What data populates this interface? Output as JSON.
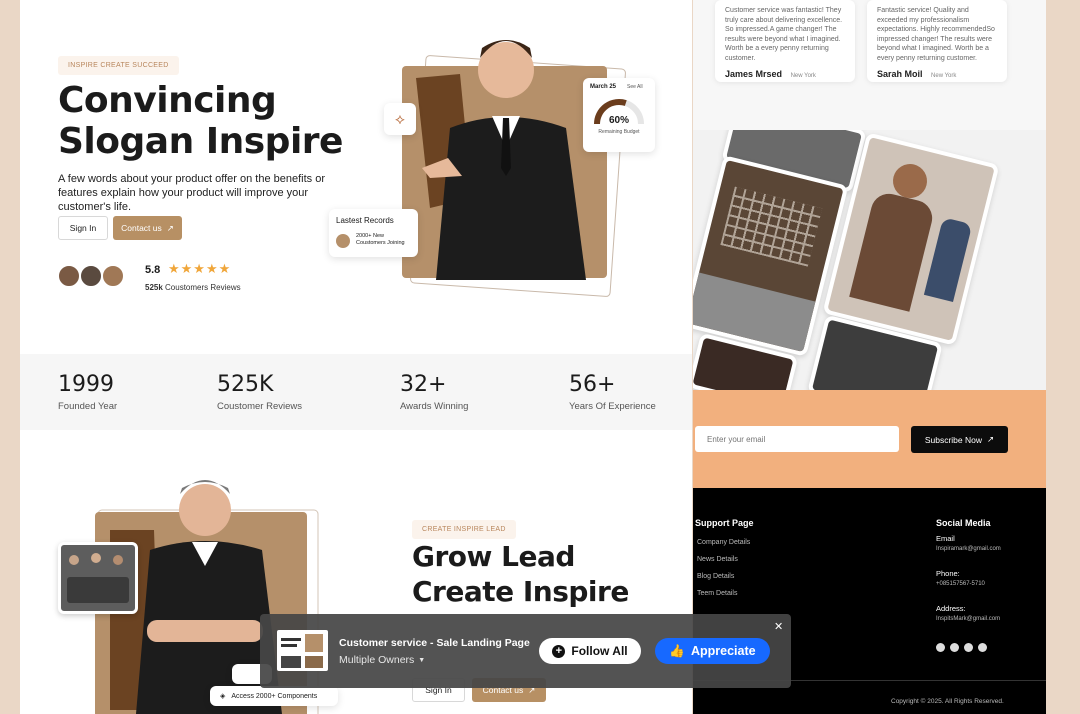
{
  "hero": {
    "tag": "INSPIRE CREATE SUCCEED",
    "title_line1": "Convincing",
    "title_line2": "Slogan Inspire",
    "lead": "A few words about your product offer on the benefits or features explain how your product will improve your customer's life.",
    "signin_label": "Sign In",
    "contact_label": "Contact us",
    "rating": "5.8",
    "reviews_count": "525k",
    "reviews_label": "Coustomers Reviews",
    "budget_card": {
      "date": "March 25",
      "see_all": "See All",
      "percent": "60%",
      "label": "Remaining Budget",
      "fraction": 0.6
    },
    "records_card": {
      "title": "Lastest Records",
      "count": "2000+ New",
      "label": "Coustomers Joining"
    }
  },
  "stats": [
    {
      "value": "1999",
      "label": "Founded Year"
    },
    {
      "value": "525K",
      "label": "Coustomer Reviews"
    },
    {
      "value": "32+",
      "label": "Awards Winning"
    },
    {
      "value": "56+",
      "label": "Years Of Experience"
    }
  ],
  "second": {
    "tag": "CREATE INSPIRE LEAD",
    "title_line1": "Grow Lead",
    "title_line2": "Create Inspire",
    "signin_label": "Sign In",
    "contact_label": "Contact us",
    "components_label": "Access 2000+ Components"
  },
  "reviews": [
    {
      "text": "Customer service was fantastic! They truly care about delivering excellence. So impressed.A game changer! The results were beyond what I imagined. Worth be a every penny returning customer.",
      "name": "James Mrsed",
      "location": "New York"
    },
    {
      "text": "Fantastic service! Quality and exceeded my professionalism expectations. Highly recommendedSo impressed changer! The results were beyond what I imagined. Worth be a every penny returning customer.",
      "name": "Sarah Moil",
      "location": "New York"
    }
  ],
  "subscribe": {
    "placeholder": "Enter your email",
    "button": "Subscribe Now"
  },
  "footer": {
    "support_title": "Support Page",
    "support_links": [
      "Company Details",
      "News Details",
      "Blog Details",
      "Teem Details"
    ],
    "social_title": "Social Media",
    "email_label": "Email",
    "email_value": "Inspiramark@gmail.com",
    "phone_label": "Phone:",
    "phone_value": "+085157567-5710",
    "address_label": "Address:",
    "address_value": "InspitsMark@gmail.com",
    "copyright": "Copyright © 2025. All Rights Reserved."
  },
  "overlay": {
    "project_title": "Customer service - Sale Landing Page",
    "owners": "Multiple Owners",
    "follow_label": "Follow All",
    "appreciate_label": "Appreciate"
  },
  "colors": {
    "accent_brown": "#b79064",
    "peach": "#f2b07e",
    "behance_blue": "#1769ff",
    "star": "#f0a63a"
  }
}
